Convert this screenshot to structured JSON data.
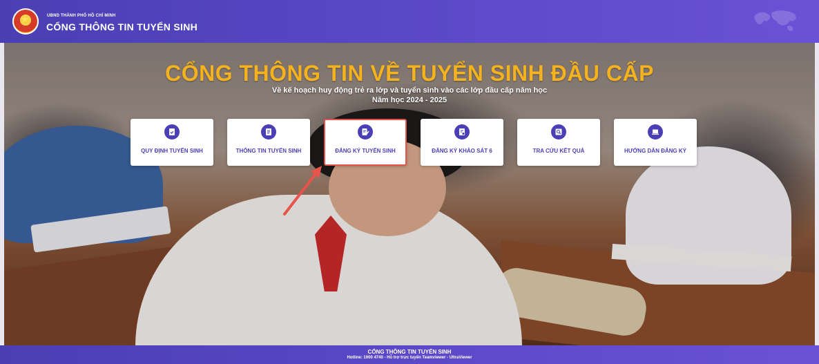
{
  "header": {
    "org": "UBND THÀNH PHỐ HỒ CHÍ MINH",
    "title": "CỔNG THÔNG TIN TUYỂN SINH",
    "logo_icon": "emblem-logo"
  },
  "hero": {
    "title": "CỔNG THÔNG TIN VỀ TUYỂN SINH ĐẦU CẤP",
    "subtitle_line1": "Về kế hoạch huy động trẻ ra lớp và tuyển sinh vào các lớp đầu cấp năm học",
    "subtitle_line2": "Năm học 2024 - 2025"
  },
  "cards": [
    {
      "label": "QUY ĐỊNH TUYỂN SINH",
      "icon": "clipboard-check-icon"
    },
    {
      "label": "THÔNG TIN TUYỂN SINH",
      "icon": "notepad-icon"
    },
    {
      "label": "ĐĂNG KÝ TUYỂN SINH",
      "icon": "document-edit-icon",
      "highlighted": true
    },
    {
      "label": "ĐĂNG KÝ KHẢO SÁT 6",
      "icon": "survey-form-icon"
    },
    {
      "label": "TRA CỨU KẾT QUẢ",
      "icon": "search-result-icon"
    },
    {
      "label": "HƯỚNG DẪN ĐĂNG KÝ",
      "icon": "laptop-guide-icon"
    }
  ],
  "footer": {
    "title": "CỔNG THÔNG TIN TUYỂN SINH",
    "hotline": "Hotline: 1900 4740 - Hỗ trợ trực tuyến Teamviewer - UltraViewer"
  },
  "colors": {
    "brand_purple": "#4b3fb6",
    "title_gold": "#f3b21e",
    "highlight_red": "#e2554d"
  }
}
